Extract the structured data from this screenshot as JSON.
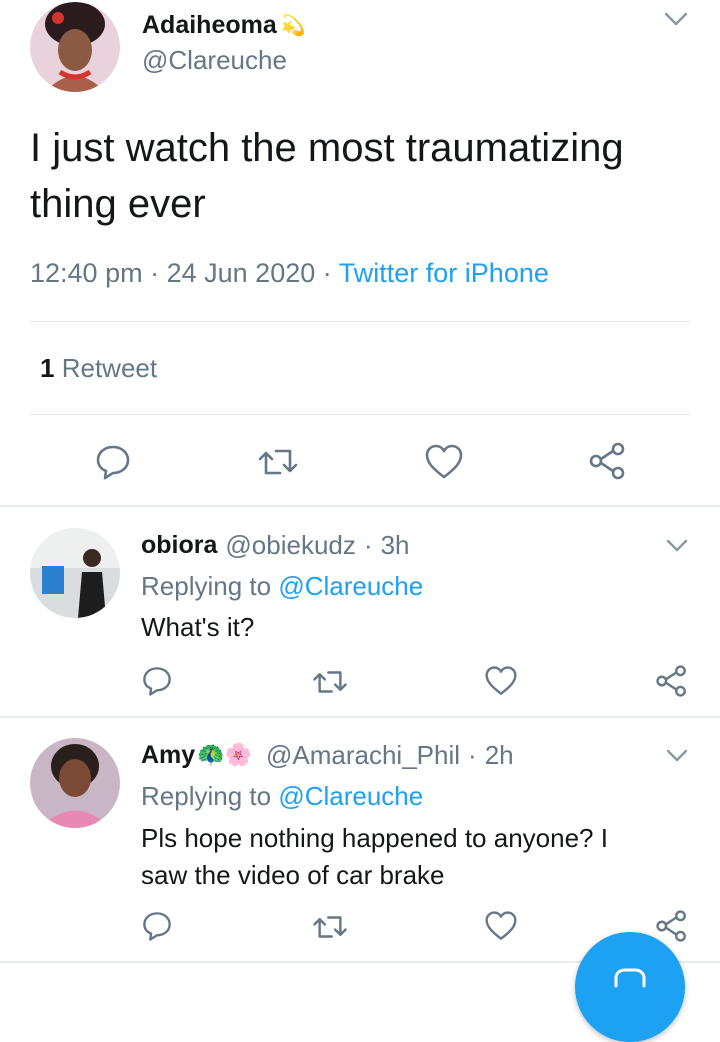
{
  "main_tweet": {
    "author_name": "Adaiheoma",
    "author_emoji": "💫",
    "handle": "@Clareuche",
    "text": "I just watch the most traumatizing thing ever",
    "time": "12:40 pm",
    "sep1": "·",
    "date": "24 Jun 2020",
    "sep2": "·",
    "source": "Twitter for iPhone",
    "retweet_count": "1",
    "retweet_label": "Retweet"
  },
  "replies": [
    {
      "name": "obiora",
      "handle": "@obiekudz",
      "sep": "·",
      "time": "3h",
      "replying_prefix": "Replying to",
      "replying_to": "@Clareuche",
      "text": "What's it?"
    },
    {
      "name": "Amy",
      "emojis": "🦚🌸",
      "handle": "@Amarachi_Phil",
      "sep": "·",
      "time": "2h",
      "replying_prefix": "Replying to",
      "replying_to": "@Clareuche",
      "text": "Pls hope nothing happened to anyone? I saw the video of car brake"
    }
  ],
  "colors": {
    "accent": "#1da1f2",
    "text": "#14171a",
    "muted": "#657786"
  },
  "icons": [
    "chevron-down-icon",
    "reply-icon",
    "retweet-icon",
    "like-icon",
    "share-icon",
    "compose-icon"
  ]
}
